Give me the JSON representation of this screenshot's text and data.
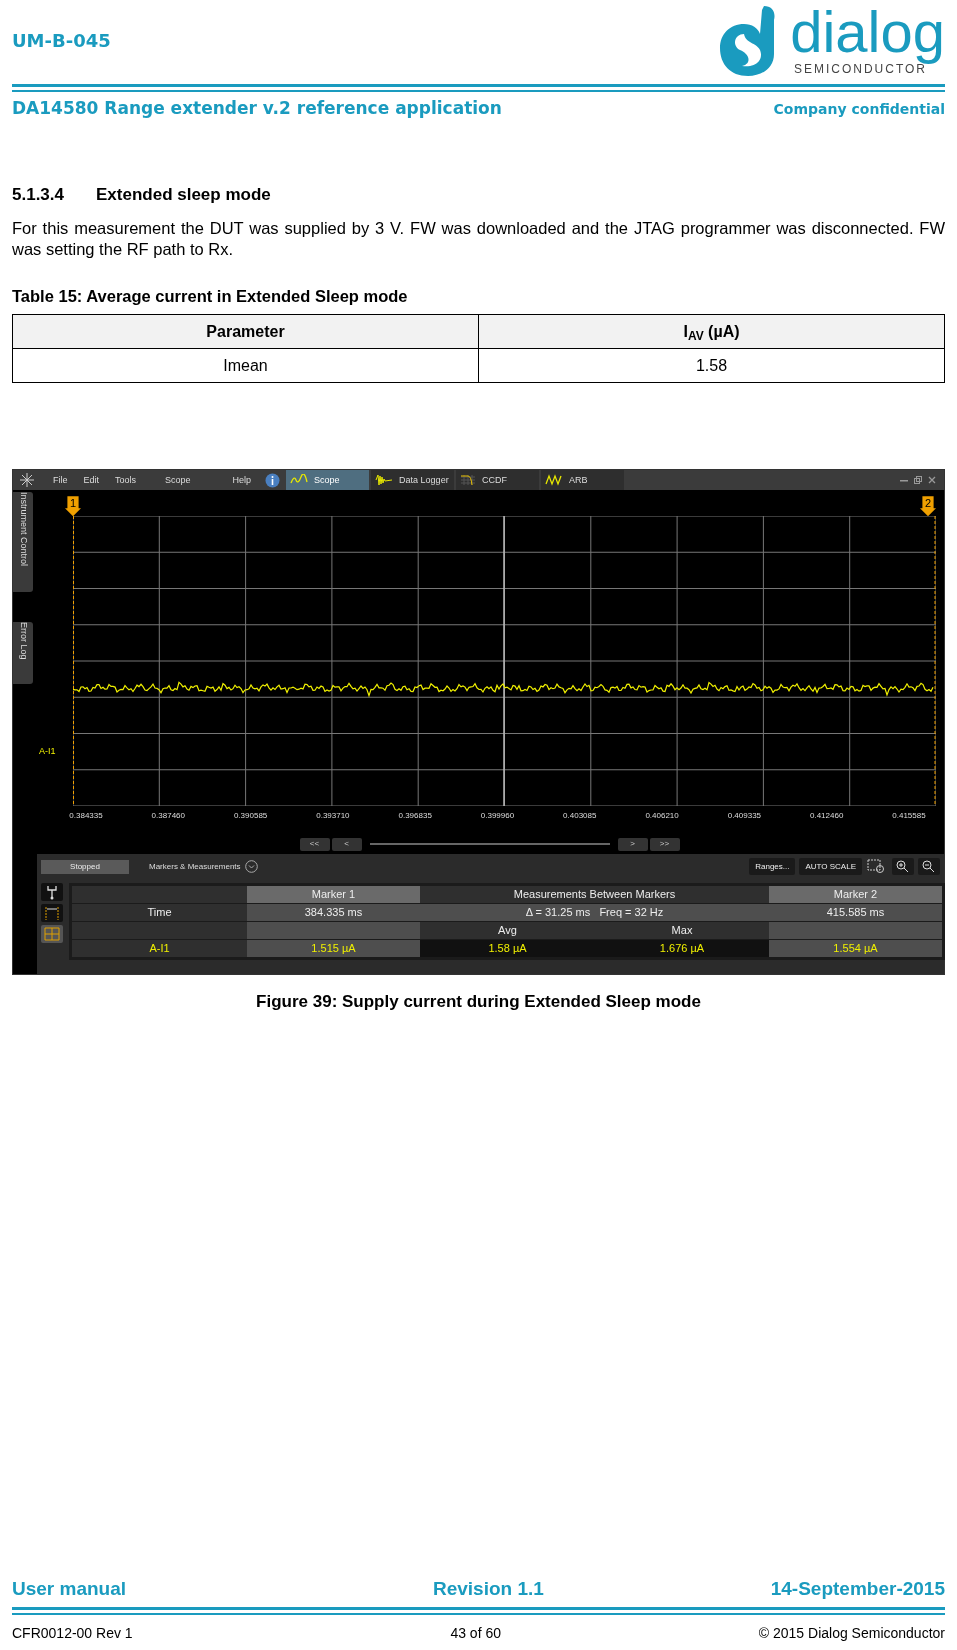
{
  "header": {
    "doc_id": "UM-B-045",
    "logo_word": "dialog",
    "logo_sub": "SEMICONDUCTOR",
    "subtitle": "DA14580 Range extender v.2 reference application",
    "confidentiality": "Company confidential"
  },
  "section": {
    "number": "5.1.3.4",
    "title": "Extended sleep mode",
    "paragraph": "For this measurement the DUT was supplied by 3 V. FW was downloaded and the JTAG programmer was disconnected. FW was setting the RF path to Rx."
  },
  "table": {
    "caption": "Table 15: Average current in Extended Sleep mode",
    "columns": [
      "Parameter",
      "I$_{AV}$ (µA)"
    ],
    "rows": [
      [
        "Imean",
        "1.58"
      ]
    ]
  },
  "scope": {
    "menu": [
      "File",
      "Edit",
      "Tools",
      "Scope",
      "Help"
    ],
    "tabs": [
      {
        "label": "Scope",
        "selected": true,
        "kind": "scope"
      },
      {
        "label": "Data Logger",
        "selected": false,
        "kind": "logger"
      },
      {
        "label": "CCDF",
        "selected": false,
        "kind": "ccdf"
      },
      {
        "label": "ARB",
        "selected": false,
        "kind": "arb"
      }
    ],
    "side_tabs": [
      "Instrument Control",
      "Error Log"
    ],
    "markers": [
      "1",
      "2"
    ],
    "channel_label": "A-I1",
    "x_ticks": [
      "0.384335",
      "0.387460",
      "0.390585",
      "0.393710",
      "0.396835",
      "0.399960",
      "0.403085",
      "0.406210",
      "0.409335",
      "0.412460",
      "0.415585"
    ],
    "nav_buttons": [
      "<<",
      "<",
      ">",
      ">>"
    ],
    "status": "Stopped",
    "panel_title": "Markers & Measurements",
    "tool_buttons": [
      "Ranges...",
      "AUTO SCALE"
    ],
    "meas": {
      "marker1_title": "Marker 1",
      "between_title": "Measurements Between Markers",
      "marker2_title": "Marker 2",
      "time_label": "Time",
      "marker1_time": "384.335 ms",
      "delta": "Δ = 31.25 ms   Freq = 32 Hz",
      "marker2_time": "415.585 ms",
      "avg_title": "Avg",
      "max_title": "Max",
      "channel": "A-I1",
      "marker1_value": "1.515 µA",
      "avg_value": "1.58 µA",
      "max_value": "1.676 µA",
      "marker2_value": "1.554 µA"
    }
  },
  "figure_caption": "Figure 39: Supply current during Extended Sleep mode",
  "footer": {
    "left": "User manual",
    "center": "Revision 1.1",
    "right": "14-September-2015",
    "bottom_left": "CFR0012-00 Rev 1",
    "bottom_center": "43 of 60",
    "bottom_right": "© 2015 Dialog Semiconductor"
  }
}
